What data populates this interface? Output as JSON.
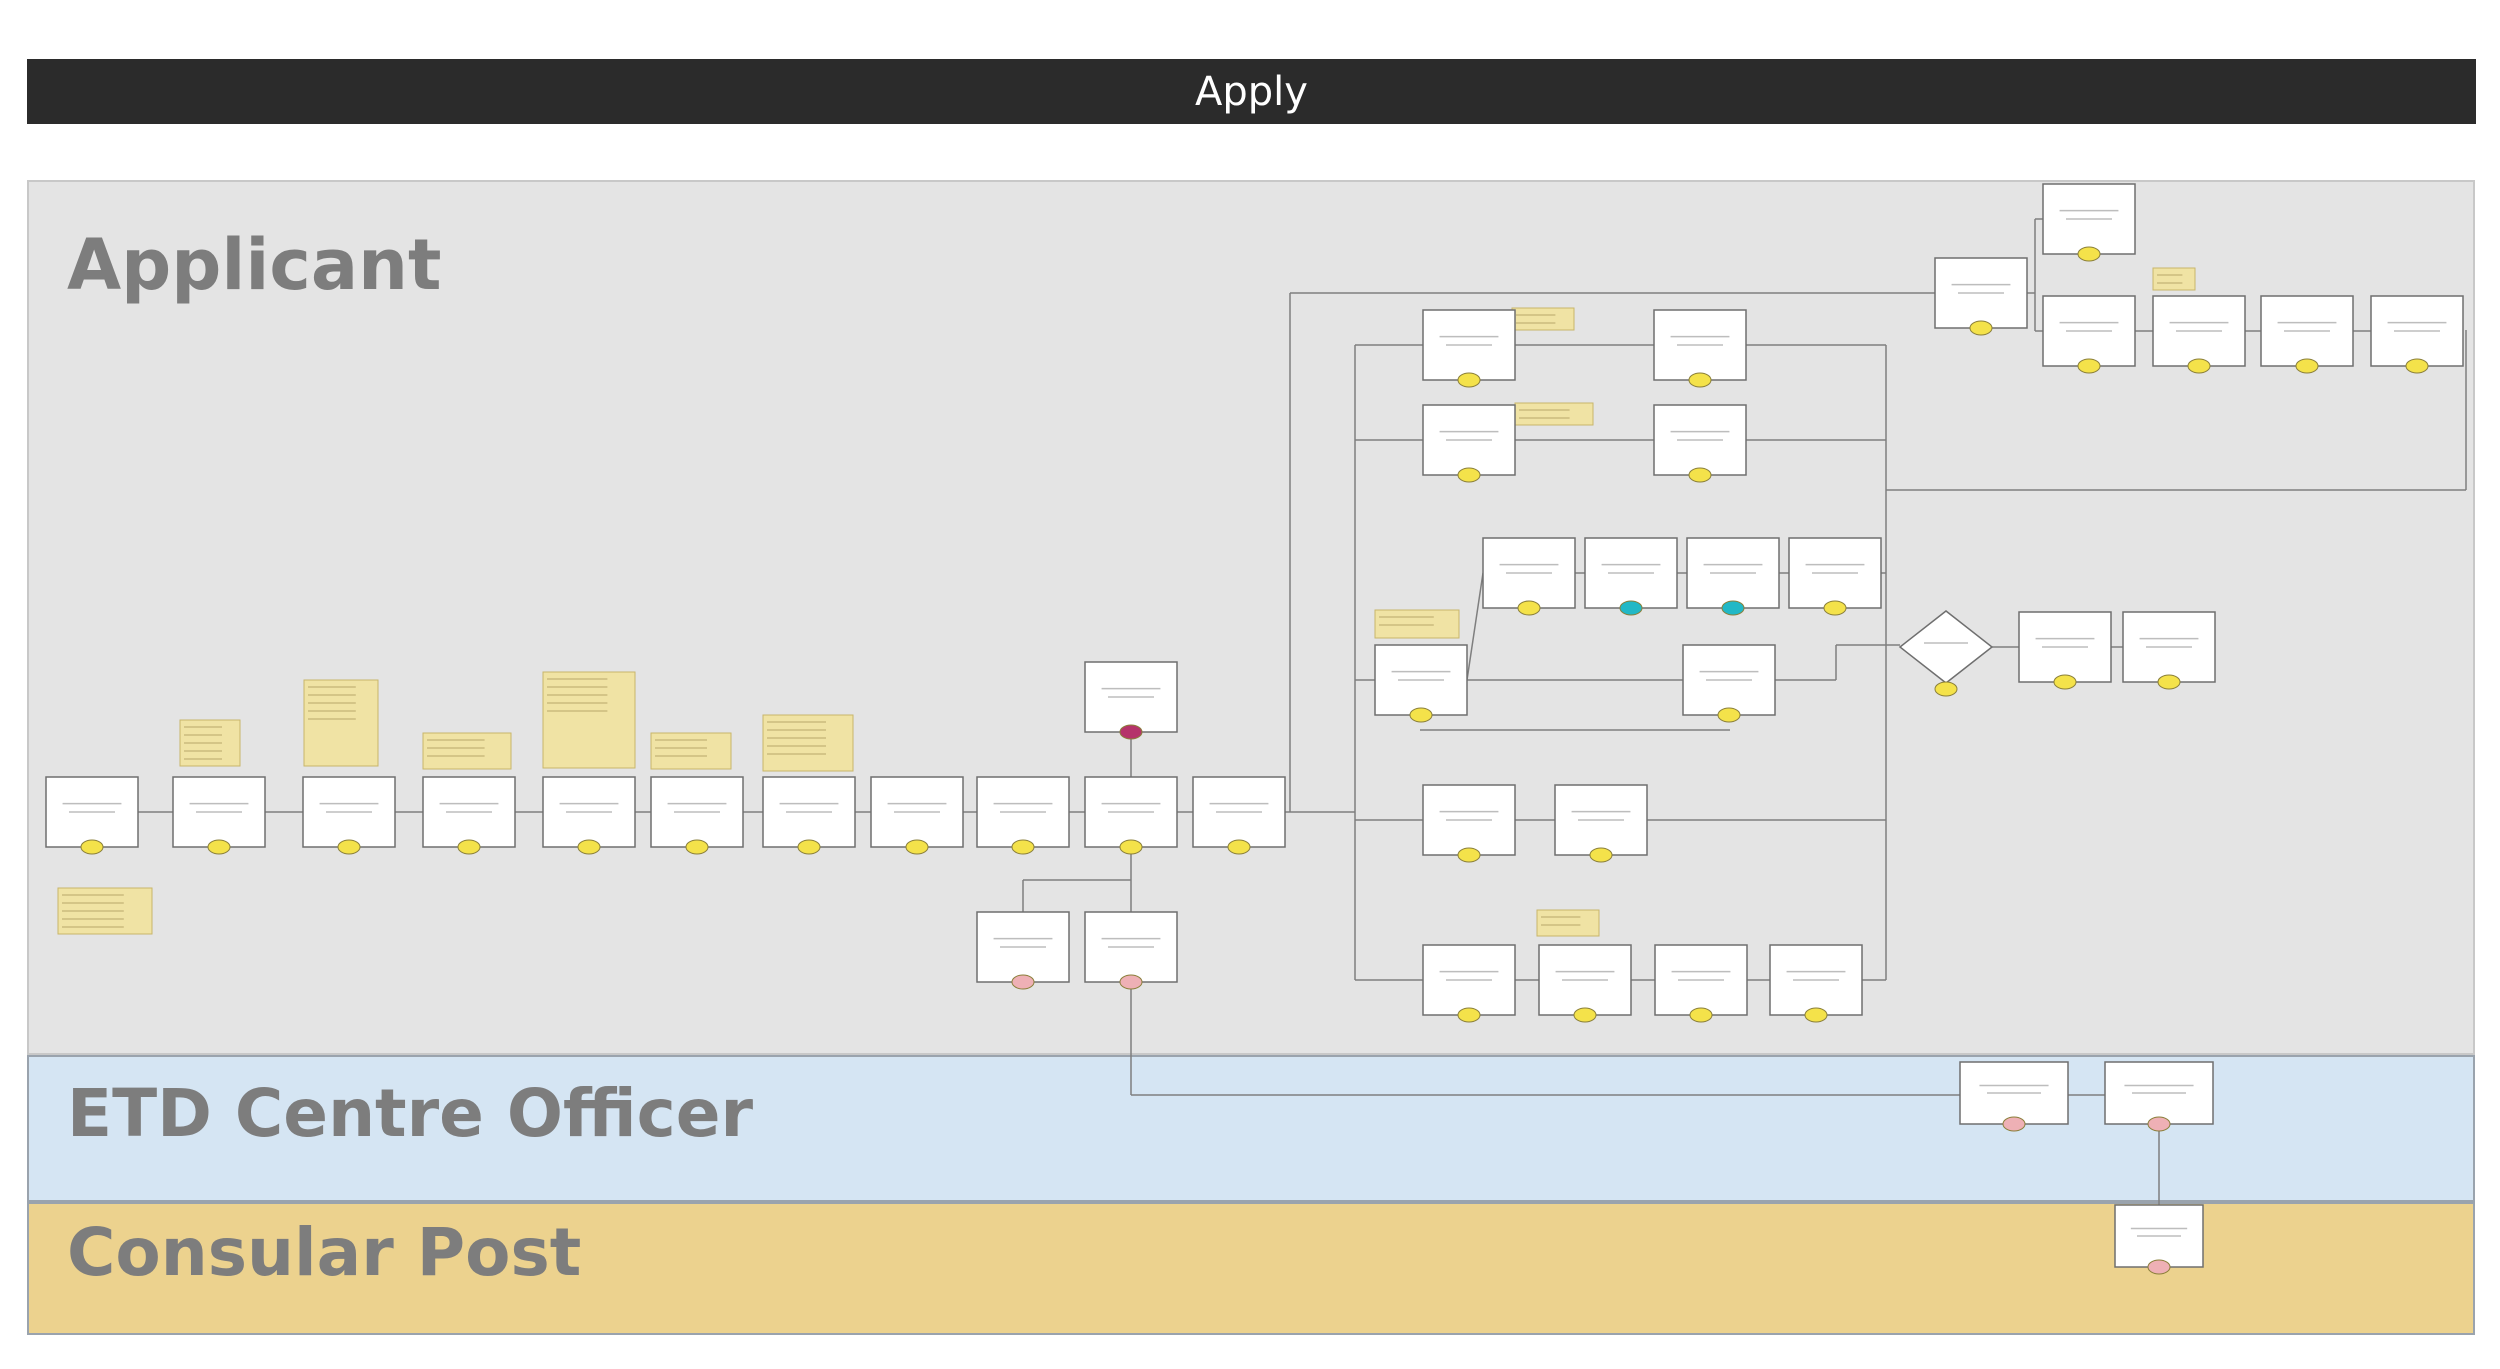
{
  "header": {
    "title": "Apply"
  },
  "lanes": {
    "applicant": "Applicant",
    "etd_officer": "ETD Centre Officer",
    "consular": "Consular Post"
  },
  "colors": {
    "header_bg": "#2b2b2b",
    "applicant_lane": "#e4e4e4",
    "etd_lane": "#d5e5f3",
    "consular_lane": "#ecd28e",
    "note": "#f0e3a4",
    "yellow_marker": "#f4e24a",
    "teal_marker": "#22b8c6",
    "pink_marker": "#eeb0b5",
    "magenta_marker": "#b5336a"
  },
  "diagram": {
    "steps": [
      {
        "id": "s1",
        "marker": "yellow"
      },
      {
        "id": "s2",
        "marker": "yellow"
      },
      {
        "id": "s3",
        "marker": "yellow"
      },
      {
        "id": "s4",
        "marker": "yellow"
      },
      {
        "id": "s5",
        "marker": "yellow"
      },
      {
        "id": "s6",
        "marker": "yellow"
      },
      {
        "id": "s7",
        "marker": "yellow"
      },
      {
        "id": "s8",
        "marker": "yellow"
      },
      {
        "id": "s9",
        "marker": "yellow"
      },
      {
        "id": "s10",
        "marker": "yellow"
      },
      {
        "id": "s11",
        "marker": "yellow"
      },
      {
        "id": "s12",
        "marker": "magenta"
      },
      {
        "id": "s13",
        "marker": "pink"
      },
      {
        "id": "s14",
        "marker": "pink"
      },
      {
        "id": "s15",
        "marker": "yellow"
      },
      {
        "id": "s16",
        "marker": "yellow"
      },
      {
        "id": "s17",
        "marker": "yellow"
      },
      {
        "id": "s18",
        "marker": "yellow"
      },
      {
        "id": "s19",
        "marker": "yellow"
      },
      {
        "id": "s20",
        "marker": "teal"
      },
      {
        "id": "s21",
        "marker": "teal"
      },
      {
        "id": "s22",
        "marker": "yellow"
      },
      {
        "id": "s23",
        "marker": "yellow"
      },
      {
        "id": "s24",
        "marker": "yellow"
      },
      {
        "id": "s25",
        "marker": "yellow"
      },
      {
        "id": "s26",
        "marker": "yellow"
      },
      {
        "id": "s27",
        "marker": "yellow"
      },
      {
        "id": "s28",
        "marker": "yellow"
      },
      {
        "id": "s29",
        "marker": "yellow"
      },
      {
        "id": "s30",
        "marker": "yellow"
      },
      {
        "id": "s31",
        "marker": "yellow"
      },
      {
        "id": "s32",
        "marker": "yellow"
      },
      {
        "id": "s33",
        "marker": "yellow"
      },
      {
        "id": "s34",
        "marker": "yellow"
      },
      {
        "id": "s35",
        "marker": "yellow"
      },
      {
        "id": "s36",
        "marker": "yellow"
      },
      {
        "id": "s37",
        "marker": "yellow"
      },
      {
        "id": "s38",
        "marker": "yellow"
      },
      {
        "id": "s39",
        "marker": "yellow"
      },
      {
        "id": "s40",
        "marker": "pink"
      },
      {
        "id": "s41",
        "marker": "pink"
      },
      {
        "id": "s42",
        "marker": "pink"
      }
    ],
    "decision": {
      "id": "d1",
      "marker": "yellow"
    },
    "note_count": 13
  }
}
